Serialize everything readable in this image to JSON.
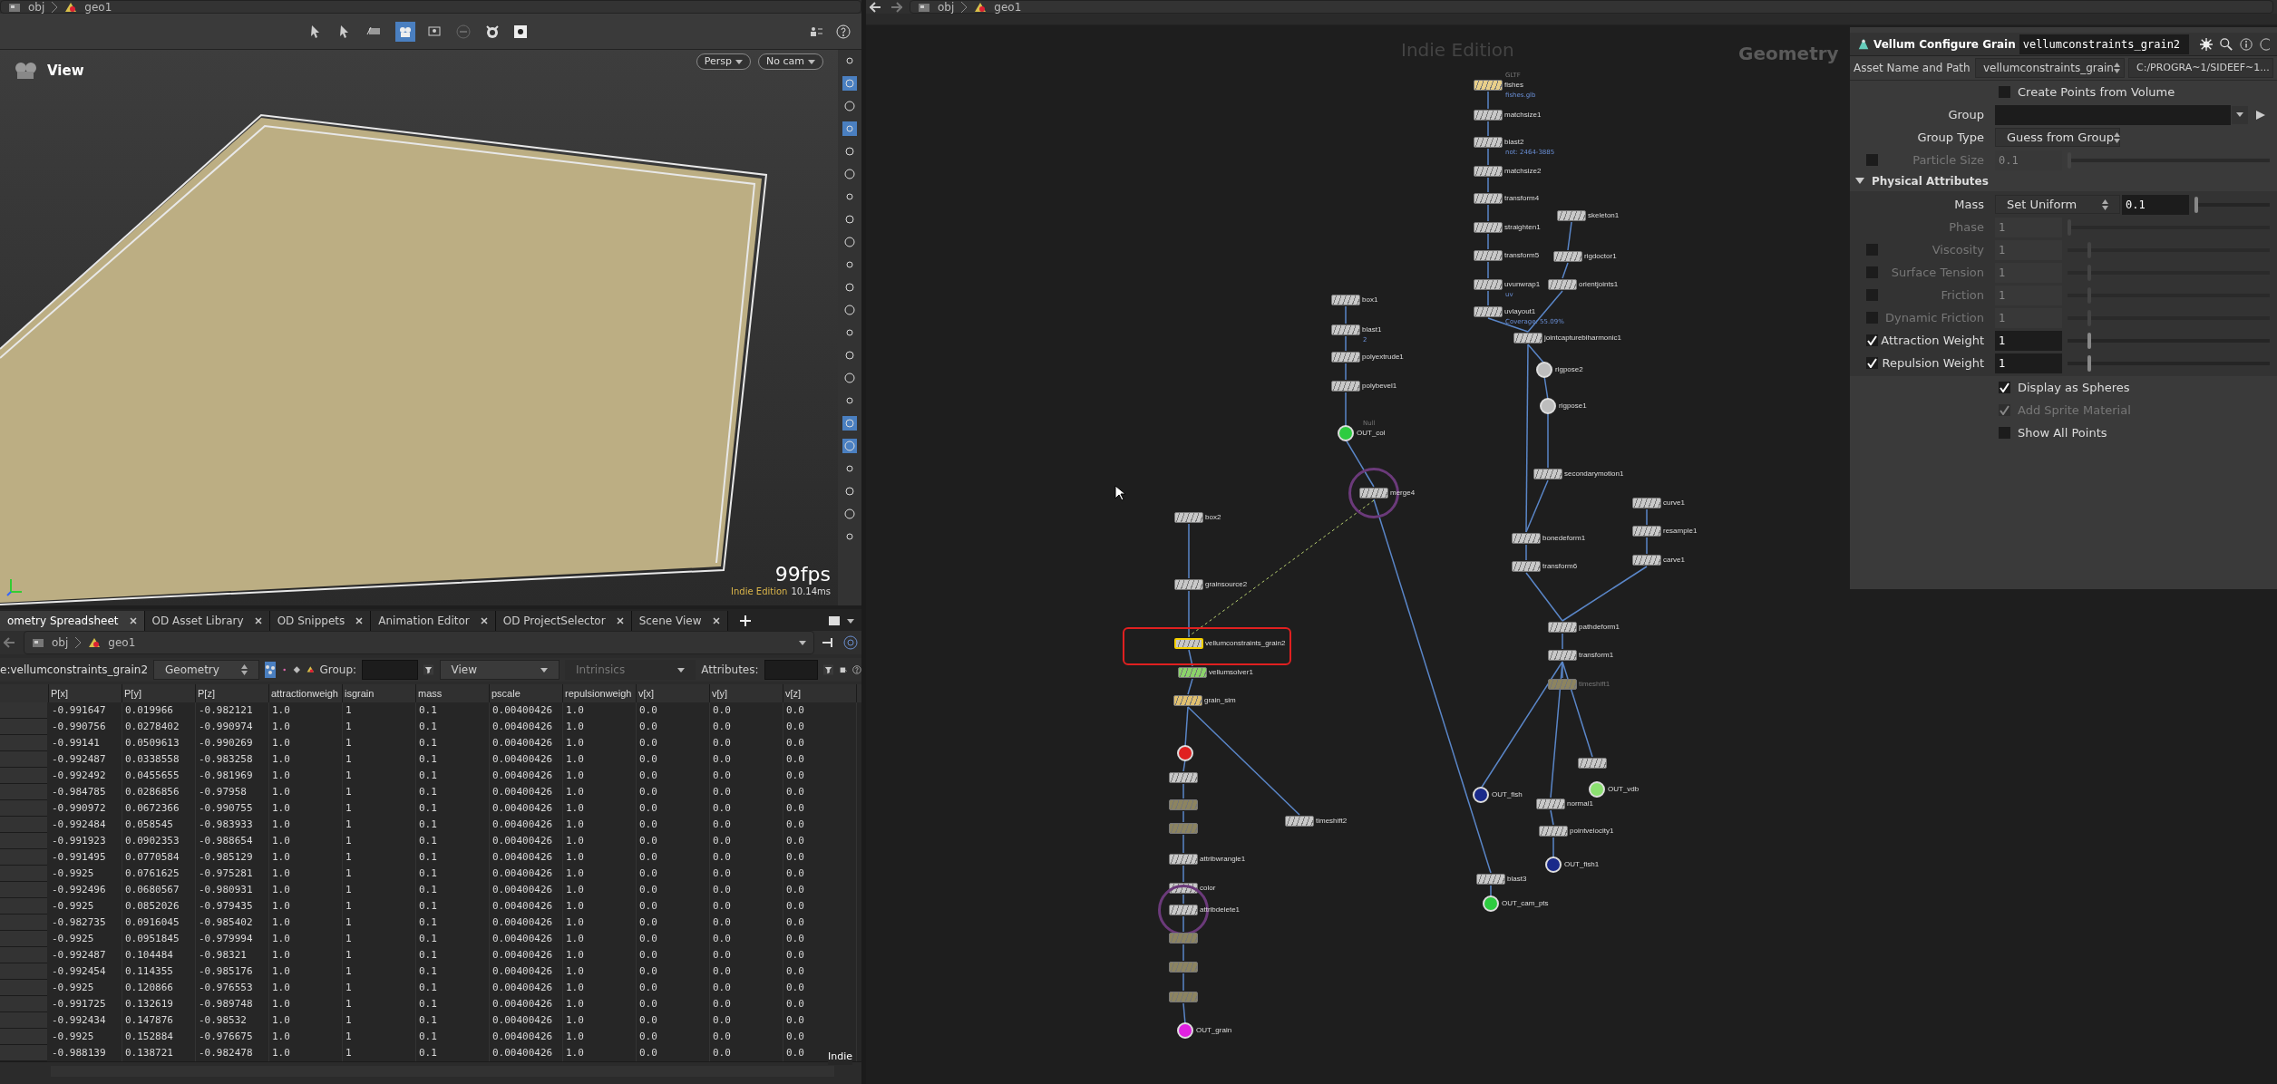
{
  "viewer": {
    "path": [
      "obj",
      "geo1"
    ],
    "title": "View",
    "camera_buttons": [
      "Persp",
      "No cam"
    ],
    "fps": "99fps",
    "edition": "Indie Edition",
    "time": "10.14ms"
  },
  "pane_tabs": [
    {
      "label": "ometry Spreadsheet",
      "selected": true
    },
    {
      "label": "OD Asset Library",
      "selected": false
    },
    {
      "label": "OD Snippets",
      "selected": false
    },
    {
      "label": "Animation Editor",
      "selected": false
    },
    {
      "label": "OD ProjectSelector",
      "selected": false
    },
    {
      "label": "Scene View",
      "selected": false
    }
  ],
  "spreadsheet": {
    "path": [
      "obj",
      "geo1"
    ],
    "node": "e:vellumconstraints_grain2",
    "mode": "Geometry",
    "group_label": "Group:",
    "view": "View",
    "intrinsics": {
      "label": "Intrinsics",
      "enabled": false
    },
    "attributes_label": "Attributes:",
    "edition": "Indie",
    "columns": [
      "P[x]",
      "P[y]",
      "P[z]",
      "attractionweigh",
      "isgrain",
      "mass",
      "pscale",
      "repulsionweigh",
      "v[x]",
      "v[y]",
      "v[z]"
    ],
    "rows": [
      [
        "-0.991647",
        "0.019966",
        "-0.982121",
        "1.0",
        "1",
        "0.1",
        "0.00400426",
        "1.0",
        "0.0",
        "0.0",
        "0.0"
      ],
      [
        "-0.990756",
        "0.0278402",
        "-0.990974",
        "1.0",
        "1",
        "0.1",
        "0.00400426",
        "1.0",
        "0.0",
        "0.0",
        "0.0"
      ],
      [
        "-0.99141",
        "0.0509613",
        "-0.990269",
        "1.0",
        "1",
        "0.1",
        "0.00400426",
        "1.0",
        "0.0",
        "0.0",
        "0.0"
      ],
      [
        "-0.992487",
        "0.0338558",
        "-0.983258",
        "1.0",
        "1",
        "0.1",
        "0.00400426",
        "1.0",
        "0.0",
        "0.0",
        "0.0"
      ],
      [
        "-0.992492",
        "0.0455655",
        "-0.981969",
        "1.0",
        "1",
        "0.1",
        "0.00400426",
        "1.0",
        "0.0",
        "0.0",
        "0.0"
      ],
      [
        "-0.984785",
        "0.0286856",
        "-0.97958",
        "1.0",
        "1",
        "0.1",
        "0.00400426",
        "1.0",
        "0.0",
        "0.0",
        "0.0"
      ],
      [
        "-0.990972",
        "0.0672366",
        "-0.990755",
        "1.0",
        "1",
        "0.1",
        "0.00400426",
        "1.0",
        "0.0",
        "0.0",
        "0.0"
      ],
      [
        "-0.992484",
        "0.058545",
        "-0.983933",
        "1.0",
        "1",
        "0.1",
        "0.00400426",
        "1.0",
        "0.0",
        "0.0",
        "0.0"
      ],
      [
        "-0.991923",
        "0.0902353",
        "-0.988654",
        "1.0",
        "1",
        "0.1",
        "0.00400426",
        "1.0",
        "0.0",
        "0.0",
        "0.0"
      ],
      [
        "-0.991495",
        "0.0770584",
        "-0.985129",
        "1.0",
        "1",
        "0.1",
        "0.00400426",
        "1.0",
        "0.0",
        "0.0",
        "0.0"
      ],
      [
        "-0.9925",
        "0.0761625",
        "-0.975281",
        "1.0",
        "1",
        "0.1",
        "0.00400426",
        "1.0",
        "0.0",
        "0.0",
        "0.0"
      ],
      [
        "-0.992496",
        "0.0680567",
        "-0.980931",
        "1.0",
        "1",
        "0.1",
        "0.00400426",
        "1.0",
        "0.0",
        "0.0",
        "0.0"
      ],
      [
        "-0.9925",
        "0.0852026",
        "-0.979435",
        "1.0",
        "1",
        "0.1",
        "0.00400426",
        "1.0",
        "0.0",
        "0.0",
        "0.0"
      ],
      [
        "-0.982735",
        "0.0916045",
        "-0.985402",
        "1.0",
        "1",
        "0.1",
        "0.00400426",
        "1.0",
        "0.0",
        "0.0",
        "0.0"
      ],
      [
        "-0.9925",
        "0.0951845",
        "-0.979994",
        "1.0",
        "1",
        "0.1",
        "0.00400426",
        "1.0",
        "0.0",
        "0.0",
        "0.0"
      ],
      [
        "-0.992487",
        "0.104484",
        "-0.98321",
        "1.0",
        "1",
        "0.1",
        "0.00400426",
        "1.0",
        "0.0",
        "0.0",
        "0.0"
      ],
      [
        "-0.992454",
        "0.114355",
        "-0.985176",
        "1.0",
        "1",
        "0.1",
        "0.00400426",
        "1.0",
        "0.0",
        "0.0",
        "0.0"
      ],
      [
        "-0.9925",
        "0.120866",
        "-0.976553",
        "1.0",
        "1",
        "0.1",
        "0.00400426",
        "1.0",
        "0.0",
        "0.0",
        "0.0"
      ],
      [
        "-0.991725",
        "0.132619",
        "-0.989748",
        "1.0",
        "1",
        "0.1",
        "0.00400426",
        "1.0",
        "0.0",
        "0.0",
        "0.0"
      ],
      [
        "-0.992434",
        "0.147876",
        "-0.98532",
        "1.0",
        "1",
        "0.1",
        "0.00400426",
        "1.0",
        "0.0",
        "0.0",
        "0.0"
      ],
      [
        "-0.9925",
        "0.152884",
        "-0.976675",
        "1.0",
        "1",
        "0.1",
        "0.00400426",
        "1.0",
        "0.0",
        "0.0",
        "0.0"
      ],
      [
        "-0.988139",
        "0.138721",
        "-0.982478",
        "1.0",
        "1",
        "0.1",
        "0.00400426",
        "1.0",
        "0.0",
        "0.0",
        "0.0"
      ]
    ]
  },
  "network": {
    "path": [
      "obj",
      "geo1"
    ],
    "edition": "Indie Edition",
    "context": "Geometry",
    "nodes": [
      {
        "label": "fishes",
        "kind": "box",
        "color": "#e8cf8a",
        "selected": false,
        "type_label": "GLTF",
        "note": "fishes.glb"
      },
      {
        "label": "matchsize1",
        "kind": "box",
        "color": "#c8c8c8",
        "selected": false
      },
      {
        "label": "blast2",
        "kind": "box",
        "color": "#c8c8c8",
        "selected": false,
        "note": "not: 2464-3885"
      },
      {
        "label": "matchsize2",
        "kind": "box",
        "color": "#c8c8c8",
        "selected": false
      },
      {
        "label": "transform4",
        "kind": "box",
        "color": "#c8c8c8",
        "selected": false
      },
      {
        "label": "straighten1",
        "kind": "box",
        "color": "#c8c8c8",
        "selected": false
      },
      {
        "label": "transform5",
        "kind": "box",
        "color": "#c8c8c8",
        "selected": false
      },
      {
        "label": "uvunwrap1",
        "kind": "box",
        "color": "#c8c8c8",
        "selected": false,
        "note": "uv"
      },
      {
        "label": "uvlayout1",
        "kind": "box",
        "color": "#c8c8c8",
        "selected": false,
        "note": "Coverage: 55.09%"
      },
      {
        "label": "skeleton1",
        "kind": "box",
        "color": "#c8c8c8",
        "selected": false
      },
      {
        "label": "rigdoctor1",
        "kind": "box",
        "color": "#c8c8c8",
        "selected": false
      },
      {
        "label": "orientjoints1",
        "kind": "box",
        "color": "#c8c8c8",
        "selected": false
      },
      {
        "label": "jointcapturebiharmonic1",
        "kind": "box",
        "color": "#c8c8c8",
        "selected": false
      },
      {
        "label": "rigpose2",
        "kind": "circle",
        "color": "#bdbdbd",
        "selected": false
      },
      {
        "label": "rigpose1",
        "kind": "circle",
        "color": "#bdbdbd",
        "selected": false
      },
      {
        "label": "secondarymotion1",
        "kind": "box",
        "color": "#c8c8c8",
        "selected": false
      },
      {
        "label": "bonedeform1",
        "kind": "box",
        "color": "#c8c8c8",
        "selected": false
      },
      {
        "label": "transform6",
        "kind": "box",
        "color": "#c8c8c8",
        "selected": false
      },
      {
        "label": "curve1",
        "kind": "box",
        "color": "#c8c8c8",
        "selected": false
      },
      {
        "label": "resample1",
        "kind": "box",
        "color": "#c8c8c8",
        "selected": false
      },
      {
        "label": "carve1",
        "kind": "box",
        "color": "#c8c8c8",
        "selected": false
      },
      {
        "label": "pathdeform1",
        "kind": "box",
        "color": "#c8c8c8",
        "selected": false
      },
      {
        "label": "transform1",
        "kind": "box",
        "color": "#c8c8c8",
        "selected": false
      },
      {
        "label": "timeshift1",
        "kind": "box",
        "color": "#8c8460",
        "selected": false
      },
      {
        "label": "box1",
        "kind": "box",
        "color": "#c8c8c8",
        "selected": false
      },
      {
        "label": "blast1",
        "kind": "box",
        "color": "#c8c8c8",
        "selected": false,
        "note": "2"
      },
      {
        "label": "polyextrude1",
        "kind": "box",
        "color": "#c8c8c8",
        "selected": false
      },
      {
        "label": "polybevel1",
        "kind": "box",
        "color": "#c8c8c8",
        "selected": false
      },
      {
        "label": "OUT_col",
        "kind": "circle",
        "color": "#2ecc40",
        "selected": false,
        "type_label": "Null"
      },
      {
        "label": "merge4",
        "kind": "ring",
        "color": "#c8c8c8",
        "selected": false
      },
      {
        "label": "box2",
        "kind": "box",
        "color": "#c8c8c8",
        "selected": false
      },
      {
        "label": "grainsource2",
        "kind": "box",
        "color": "#c8c8c8",
        "selected": false
      },
      {
        "label": "vellumconstraints_grain2",
        "kind": "box",
        "color": "#c8c8c8",
        "selected": true
      },
      {
        "label": "vellumsolver1",
        "kind": "box",
        "color": "#8bd36a",
        "selected": false
      },
      {
        "label": "grain_sim",
        "kind": "box",
        "color": "#e0c070",
        "selected": false
      },
      {
        "kind": "circle",
        "color": "#e02020",
        "selected": false
      },
      {
        "kind": "box",
        "color": "#c8c8c8",
        "selected": false
      },
      {
        "kind": "box",
        "color": "#8c8460",
        "selected": false
      },
      {
        "kind": "box",
        "color": "#8c8460",
        "selected": false
      },
      {
        "label": "attribwrangle1",
        "kind": "box",
        "color": "#c8c8c8",
        "selected": false
      },
      {
        "label": "color",
        "kind": "box",
        "color": "#c8c8c8",
        "selected": false
      },
      {
        "label": "attribdelete1",
        "kind": "ring",
        "color": "#c8c8c8",
        "selected": false
      },
      {
        "kind": "box",
        "color": "#8c8460",
        "selected": false
      },
      {
        "kind": "box",
        "color": "#8c8460",
        "selected": false
      },
      {
        "kind": "box",
        "color": "#8c8460",
        "selected": false
      },
      {
        "label": "OUT_grain",
        "kind": "circle",
        "color": "#e020e0",
        "selected": false
      },
      {
        "label": "timeshift2",
        "kind": "box",
        "color": "#c8c8c8",
        "selected": false
      },
      {
        "label": "OUT_fish",
        "kind": "circle",
        "color": "#1a2a8a",
        "selected": false
      },
      {
        "label": "blast3",
        "kind": "box",
        "color": "#c8c8c8",
        "selected": false
      },
      {
        "label": "OUT_cam_pts",
        "kind": "circle",
        "color": "#2ecc40",
        "selected": false
      },
      {
        "kind": "box",
        "color": "#c8c8c8",
        "selected": false
      },
      {
        "label": "OUT_vdb",
        "kind": "circle",
        "color": "#8be070",
        "selected": false
      },
      {
        "label": "normal1",
        "kind": "box",
        "color": "#c8c8c8",
        "selected": false
      },
      {
        "label": "pointvelocity1",
        "kind": "box",
        "color": "#c8c8c8",
        "selected": false
      },
      {
        "label": "OUT_fish1",
        "kind": "circle",
        "color": "#1a2a8a",
        "selected": false
      }
    ]
  },
  "parameters": {
    "node_type": "Vellum Configure Grain",
    "node_name": "vellumconstraints_grain2",
    "asset_label": "Asset Name and Path",
    "asset_name": "vellumconstraints_grain",
    "asset_path": "C:/PROGRA~1/SIDEEF~1...",
    "rows": [
      {
        "kind": "toggle",
        "label": "Create Points from Volume",
        "checked": false,
        "enabled": true
      },
      {
        "kind": "field",
        "label": "Group",
        "enabled": true
      },
      {
        "kind": "menu",
        "label": "Group Type",
        "value": "Guess from Group",
        "enabled": true
      },
      {
        "kind": "slider",
        "label": "Particle Size",
        "value": "0.1",
        "level": 0,
        "enabled": false,
        "checked": false
      }
    ],
    "section": {
      "label": "Physical Attributes",
      "expanded": true,
      "rows": [
        {
          "kind": "menu_slider",
          "label": "Mass",
          "menu": "Set Uniform",
          "value": "0.1",
          "level": 0,
          "enabled": true
        },
        {
          "kind": "slider",
          "label": "Phase",
          "value": "1",
          "level": 0,
          "enabled": false
        },
        {
          "kind": "slider",
          "label": "Viscosity",
          "value": "1",
          "level": 0.1,
          "enabled": false,
          "checked": false
        },
        {
          "kind": "slider",
          "label": "Surface Tension",
          "value": "1",
          "level": 0.1,
          "enabled": false,
          "checked": false
        },
        {
          "kind": "slider",
          "label": "Friction",
          "value": "1",
          "level": 0.1,
          "enabled": false,
          "checked": false
        },
        {
          "kind": "slider",
          "label": "Dynamic Friction",
          "value": "1",
          "level": 0.1,
          "enabled": false,
          "checked": false
        },
        {
          "kind": "slider",
          "label": "Attraction Weight",
          "value": "1",
          "level": 0.1,
          "enabled": true,
          "checked": true
        },
        {
          "kind": "slider",
          "label": "Repulsion Weight",
          "value": "1",
          "level": 0.1,
          "enabled": true,
          "checked": true
        }
      ]
    },
    "after": [
      {
        "kind": "toggle",
        "label": "Display as Spheres",
        "checked": true,
        "enabled": true
      },
      {
        "kind": "toggle",
        "label": "Add Sprite Material",
        "checked": true,
        "enabled": false
      },
      {
        "kind": "toggle",
        "label": "Show All Points",
        "checked": false,
        "enabled": true
      }
    ]
  }
}
